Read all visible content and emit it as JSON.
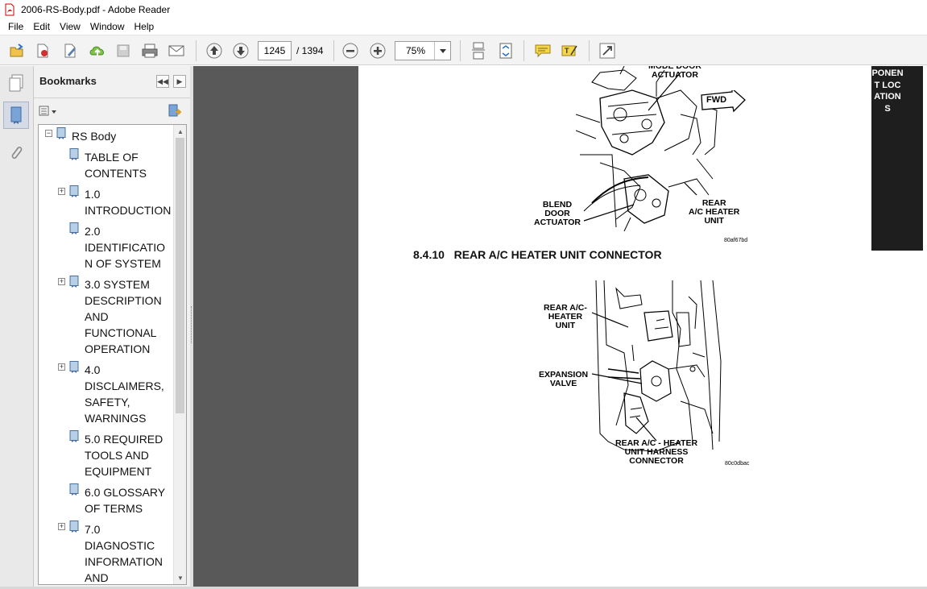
{
  "window": {
    "title": "2006-RS-Body.pdf - Adobe Reader"
  },
  "menu": {
    "items": [
      "File",
      "Edit",
      "View",
      "Window",
      "Help"
    ]
  },
  "toolbar": {
    "page_current": "1245",
    "page_total": "/ 1394",
    "zoom": "75%",
    "icons": [
      "open-icon",
      "create-pdf-icon",
      "edit-icon",
      "upload-icon",
      "save-icon",
      "print-icon",
      "email-icon",
      "previous-page-icon",
      "next-page-icon",
      "zoom-out-icon",
      "zoom-in-icon",
      "scroll-mode-icon",
      "fit-page-icon",
      "comment-icon",
      "highlight-icon",
      "expand-icon"
    ]
  },
  "bookmarks": {
    "title": "Bookmarks",
    "items": [
      {
        "lines": [
          "RS Body"
        ],
        "expander": "−"
      },
      {
        "lines": [
          "TABLE OF",
          "CONTENTS"
        ],
        "expander": ""
      },
      {
        "lines": [
          "1.0",
          "INTRODUCTION"
        ],
        "expander": "+"
      },
      {
        "lines": [
          "2.0",
          "IDENTIFICATIO",
          "N OF SYSTEM"
        ],
        "expander": ""
      },
      {
        "lines": [
          "3.0 SYSTEM",
          "DESCRIPTION",
          "AND",
          "FUNCTIONAL",
          "OPERATION"
        ],
        "expander": "+"
      },
      {
        "lines": [
          "4.0",
          "DISCLAIMERS,",
          "SAFETY,",
          "WARNINGS"
        ],
        "expander": "+"
      },
      {
        "lines": [
          "5.0 REQUIRED",
          "TOOLS AND",
          "EQUIPMENT"
        ],
        "expander": ""
      },
      {
        "lines": [
          "6.0 GLOSSARY",
          "OF TERMS"
        ],
        "expander": ""
      },
      {
        "lines": [
          "7.0",
          "DIAGNOSTIC",
          "INFORMATION",
          "AND"
        ],
        "expander": "+"
      }
    ]
  },
  "document": {
    "side_tab": "PONENT LOCATIONS",
    "section_heading": "8.4.10   REAR A/C HEATER UNIT CONNECTOR",
    "figure1": {
      "labels": {
        "mode_door": "MODE DOOR\nACTUATOR",
        "fwd": "FWD",
        "blend_door": "BLEND\nDOOR\nACTUATOR",
        "rear_heater": "REAR\nA/C HEATER\nUNIT"
      },
      "code": "80af67bd"
    },
    "figure2": {
      "labels": {
        "rear_ac_heater": "REAR A/C-\nHEATER\nUNIT",
        "expansion_valve": "EXPANSION\nVALVE",
        "harness": "REAR A/C - HEATER\nUNIT HARNESS\nCONNECTOR"
      },
      "code": "80c0dbac"
    }
  }
}
